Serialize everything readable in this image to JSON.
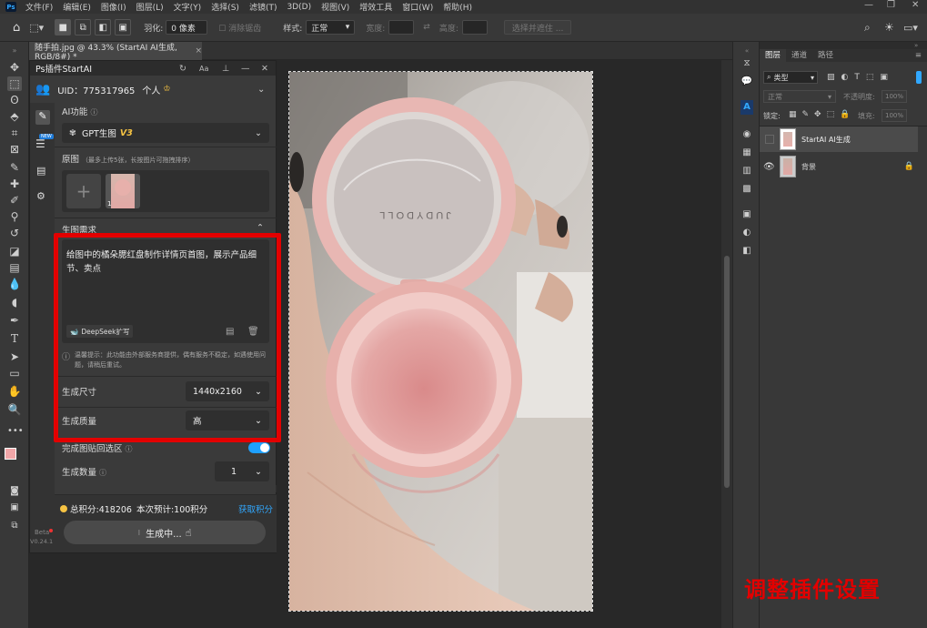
{
  "menu": {
    "logo": "Ps",
    "items": [
      "文件(F)",
      "编辑(E)",
      "图像(I)",
      "图层(L)",
      "文字(Y)",
      "选择(S)",
      "滤镜(T)",
      "3D(D)",
      "视图(V)",
      "增效工具",
      "窗口(W)",
      "帮助(H)"
    ]
  },
  "options": {
    "feather_label": "羽化:",
    "feather_value": "0 像素",
    "antialias": "消除锯齿",
    "style_label": "样式:",
    "style_value": "正常",
    "width_label": "宽度:",
    "height_label": "高度:",
    "select_mask": "选择并遮住 ..."
  },
  "doc": {
    "tab_title": "随手拍.jpg @ 43.3% (StartAI AI生成, RGB/8#) *",
    "close": "×"
  },
  "plugin": {
    "title": "Ps插件StartAI",
    "uid": "UID：775317965",
    "account_type": "个人",
    "ai_function_label": "AI功能",
    "ai_function_value": "GPT生图",
    "ai_function_version": "V3",
    "source_label": "原图",
    "source_hint": "（最多上传5张，长按图片可拖拽排序）",
    "thumb_index": "1",
    "requirements_label": "生图需求",
    "prompt": "给图中的橘朵腮红盘制作详情页首图，展示产品细节、卖点",
    "deepseek_label": "DeepSeek扩写",
    "notice": "温馨提示：此功能由外部服务商提供，偶有服务不稳定，如遇使用问题，请稍后重试。",
    "size_label": "生成尺寸",
    "size_value": "1440x2160",
    "quality_label": "生成质量",
    "quality_value": "高",
    "paste_back_label": "完成图贴回选区",
    "count_label": "生成数量",
    "count_value": "1",
    "total_points": "总积分:418206",
    "estimate": "本次预计:100积分",
    "get_points": "获取积分",
    "generating": "生成中...",
    "beta": "Beta",
    "version": "V0.24.1",
    "new_badge": "NEW"
  },
  "layers": {
    "tabs": [
      "图层",
      "通道",
      "路径"
    ],
    "filter_kind": "类型",
    "blend_mode": "正常",
    "opacity_label": "不透明度:",
    "opacity_value": "100%",
    "lock_label": "锁定:",
    "fill_label": "填充:",
    "fill_value": "100%",
    "items": [
      {
        "name": "StartAI AI生成"
      },
      {
        "name": "背景"
      }
    ]
  },
  "annotation": {
    "text": "调整插件设置"
  },
  "colors": {
    "highlight": "#e30000",
    "accent": "#31a8ff",
    "toggle": "#1ea0ff",
    "gold": "#f6c343"
  }
}
